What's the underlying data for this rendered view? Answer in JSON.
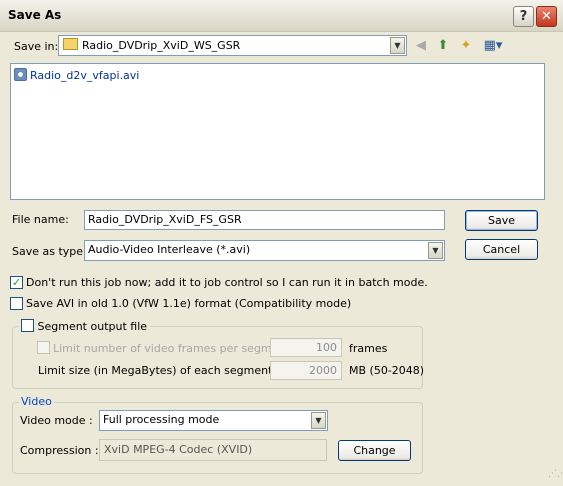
{
  "window": {
    "title": "Save As"
  },
  "titlebar": {
    "help_glyph": "?",
    "close_glyph": "✕"
  },
  "save_in": {
    "label": "Save in:",
    "value": "Radio_DVDrip_XviD_WS_GSR"
  },
  "toolbar": {
    "icons": [
      "back-icon",
      "up-folder-icon",
      "new-folder-icon",
      "view-menu-icon"
    ]
  },
  "files": [
    {
      "name": "Radio_d2v_vfapi.avi"
    }
  ],
  "filename": {
    "label": "File name:",
    "value": "Radio_DVDrip_XviD_FS_GSR"
  },
  "filetype": {
    "label": "Save as type:",
    "value": "Audio-Video Interleave (*.avi)"
  },
  "buttons": {
    "save": "Save",
    "cancel": "Cancel",
    "change": "Change"
  },
  "options": {
    "batch": {
      "label": "Don't run this job now; add it to job control so I can run it in batch mode.",
      "checked": true
    },
    "old_avi": {
      "label": "Save AVI in old 1.0 (VfW 1.1e) format (Compatibility mode)",
      "checked": false
    }
  },
  "segment": {
    "label": "Segment output file",
    "limit_frames_label": "Limit number of video frames per segment to",
    "limit_frames_value": "100",
    "frames_unit": "frames",
    "limit_size_label": "Limit size (in MegaBytes) of each segment to :",
    "limit_size_value": "2000",
    "size_unit": "MB (50-2048)"
  },
  "video": {
    "group_label": "Video",
    "mode_label": "Video mode :",
    "mode_value": "Full processing mode",
    "compression_label": "Compression :",
    "compression_value": "XviD MPEG-4 Codec (XVID)"
  },
  "colors": {
    "titlebar": "#e8e6da",
    "dialog_bg": "#ece9d8",
    "close_button": "#c2381f",
    "group_title": "#0046d5"
  }
}
